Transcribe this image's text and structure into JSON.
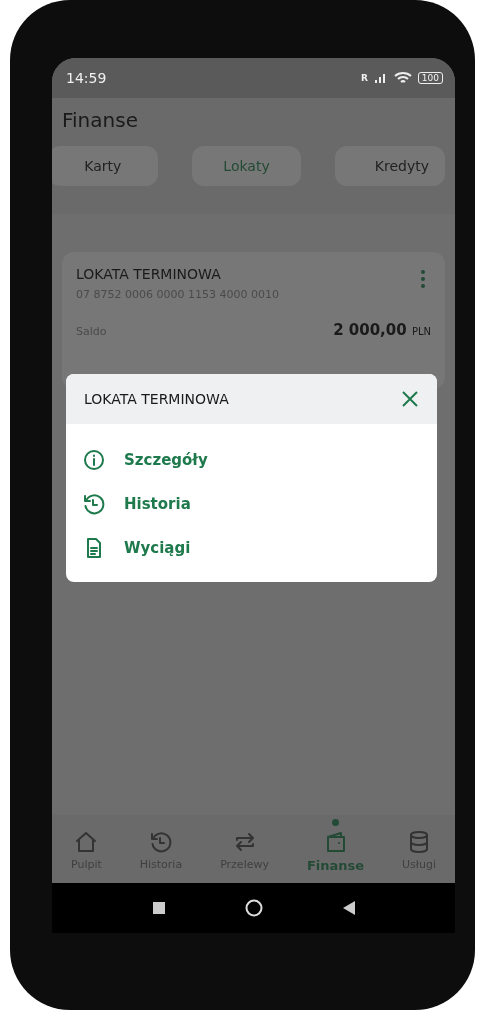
{
  "status_bar": {
    "time": "14:59",
    "battery": "100",
    "network": "R"
  },
  "header": {
    "title": "Finanse"
  },
  "tabs": [
    {
      "label": "Karty",
      "selected": false
    },
    {
      "label": "Lokaty",
      "selected": true
    },
    {
      "label": "Kredyty",
      "selected": false
    }
  ],
  "account_card": {
    "name": "LOKATA TERMINOWA",
    "number": "07 8752 0006 0000 1153 4000 0010",
    "balance_label": "Saldo",
    "balance": "2 000,00",
    "currency": "PLN"
  },
  "modal": {
    "title": "LOKATA TERMINOWA",
    "items": [
      {
        "kind": "info",
        "label": "Szczegóły"
      },
      {
        "kind": "history",
        "label": "Historia"
      },
      {
        "kind": "document",
        "label": "Wyciągi"
      }
    ]
  },
  "bottom_nav": [
    {
      "kind": "home",
      "label": "Pulpit",
      "selected": false
    },
    {
      "kind": "history",
      "label": "Historia",
      "selected": false
    },
    {
      "kind": "transfer",
      "label": "Przelewy",
      "selected": false
    },
    {
      "kind": "wallet",
      "label": "Finanse",
      "selected": true
    },
    {
      "kind": "database",
      "label": "Usługi",
      "selected": false
    }
  ]
}
